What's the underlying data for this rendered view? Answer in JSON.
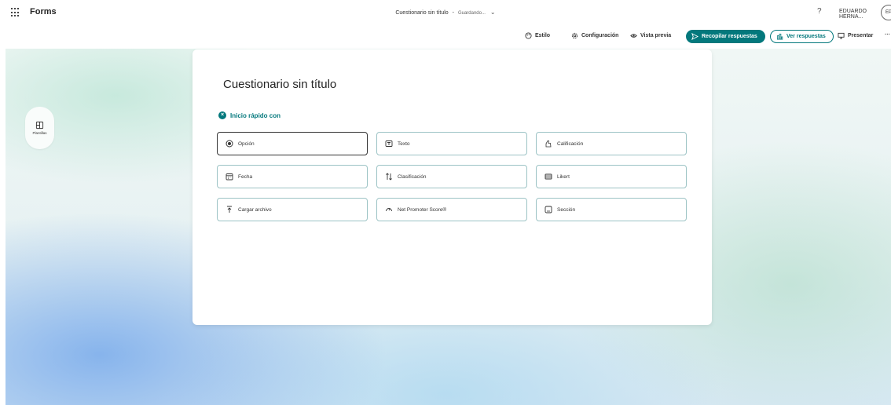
{
  "app": {
    "name": "Forms"
  },
  "doc": {
    "title": "Cuestionario sin título",
    "separator": "-",
    "status": "Guardando...",
    "chevron": "⌄"
  },
  "user": {
    "help": "?",
    "name": "EDUARDO HERNA...",
    "initials": "EP"
  },
  "toolbar": {
    "style": "Estilo",
    "settings": "Configuración",
    "preview": "Vista previa",
    "collect": "Recopilar respuestas",
    "view_responses": "Ver respuestas",
    "present": "Presentar",
    "more": "···"
  },
  "sidebar": {
    "templates": "Plantillas"
  },
  "form": {
    "title": "Cuestionario sin título",
    "quick_start": "Inicio rápido con",
    "options": [
      {
        "label": "Opción",
        "icon": "radio-icon"
      },
      {
        "label": "Texto",
        "icon": "text-icon"
      },
      {
        "label": "Calificación",
        "icon": "thumb-icon"
      },
      {
        "label": "Fecha",
        "icon": "calendar-icon"
      },
      {
        "label": "Clasificación",
        "icon": "sort-icon"
      },
      {
        "label": "Likert",
        "icon": "likert-icon"
      },
      {
        "label": "Cargar archivo",
        "icon": "upload-icon"
      },
      {
        "label": "Net Promoter Score®",
        "icon": "gauge-icon"
      },
      {
        "label": "Sección",
        "icon": "section-icon"
      }
    ]
  },
  "colors": {
    "accent": "#03787c",
    "text": "#242424"
  }
}
